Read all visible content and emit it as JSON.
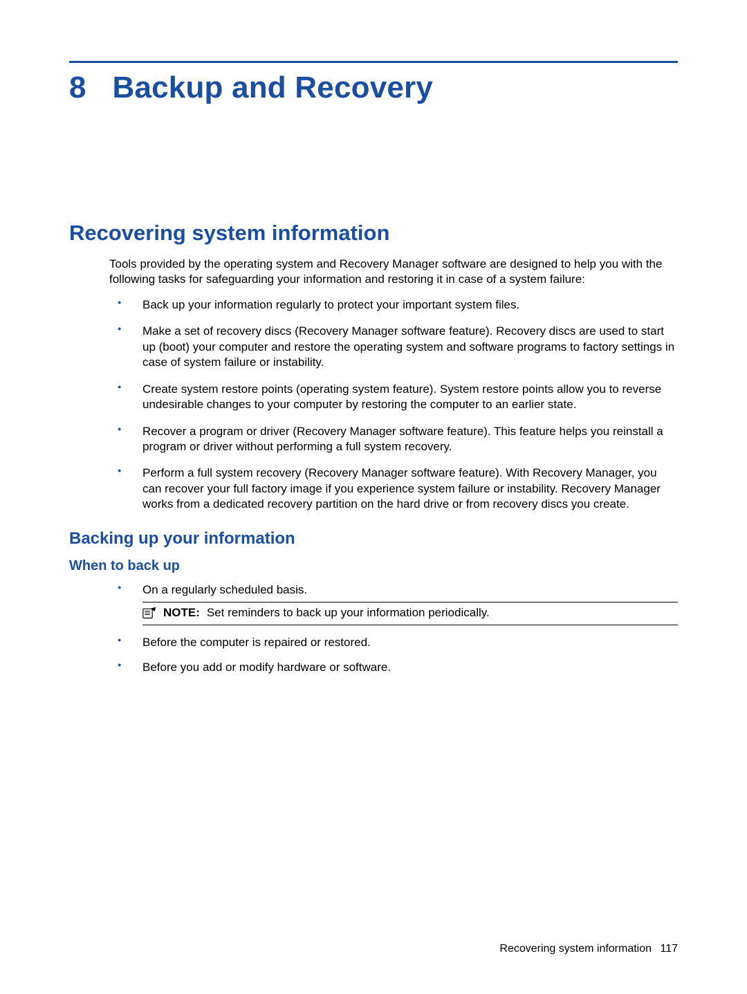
{
  "chapter": {
    "number": "8",
    "title": "Backup and Recovery"
  },
  "section1": {
    "heading": "Recovering system information",
    "intro": "Tools provided by the operating system and Recovery Manager software are designed to help you with the following tasks for safeguarding your information and restoring it in case of a system failure:",
    "bullets": [
      "Back up your information regularly to protect your important system files.",
      "Make a set of recovery discs (Recovery Manager software feature). Recovery discs are used to start up (boot) your computer and restore the operating system and software programs to factory settings in case of system failure or instability.",
      "Create system restore points (operating system feature). System restore points allow you to reverse undesirable changes to your computer by restoring the computer to an earlier state.",
      "Recover a program or driver (Recovery Manager software feature). This feature helps you reinstall a program or driver without performing a full system recovery.",
      "Perform a full system recovery (Recovery Manager software feature). With Recovery Manager, you can recover your full factory image if you experience system failure or instability. Recovery Manager works from a dedicated recovery partition on the hard drive or from recovery discs you create."
    ]
  },
  "section2": {
    "heading": "Backing up your information",
    "sub": {
      "heading": "When to back up",
      "bullets": {
        "b0": "On a regularly scheduled basis.",
        "note_label": "NOTE:",
        "note_text": "Set reminders to back up your information periodically.",
        "b1": "Before the computer is repaired or restored.",
        "b2": "Before you add or modify hardware or software."
      }
    }
  },
  "footer": {
    "text": "Recovering system information",
    "page": "117"
  }
}
